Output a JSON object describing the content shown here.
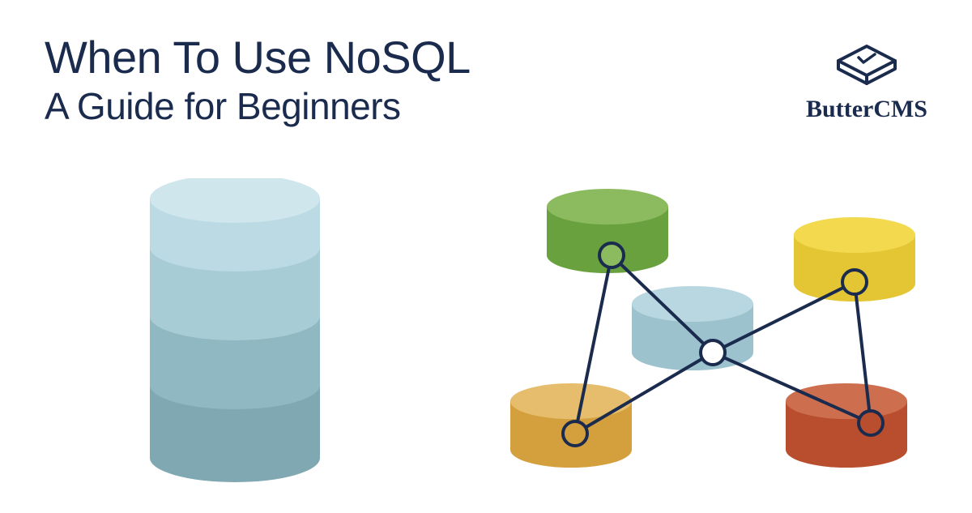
{
  "header": {
    "title": "When To Use NoSQL",
    "subtitle": "A Guide for Beginners"
  },
  "brand": {
    "name": "ButterCMS"
  },
  "colors": {
    "text": "#1a2b4e",
    "stroke": "#1a2b4e"
  }
}
